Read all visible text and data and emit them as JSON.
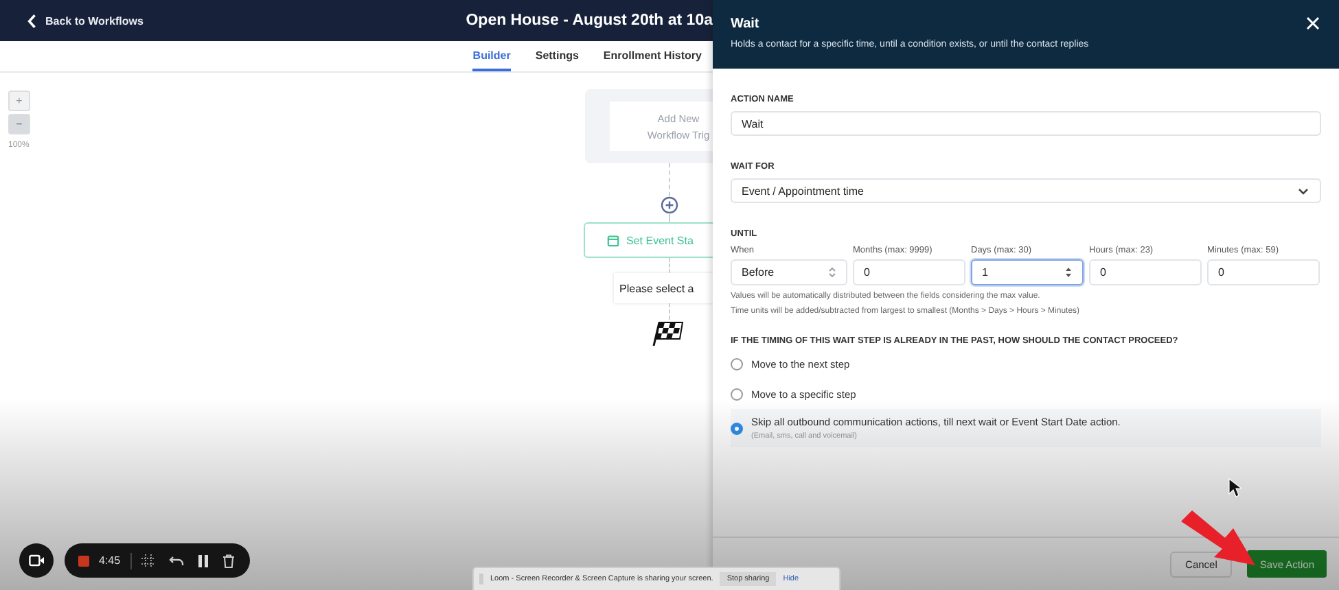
{
  "topbar": {
    "back_label": "Back to Workflows",
    "title": "Open House - August 20th at 10a"
  },
  "tabs": [
    {
      "label": "Builder",
      "selected": true
    },
    {
      "label": "Settings",
      "selected": false
    },
    {
      "label": "Enrollment History",
      "selected": false
    }
  ],
  "zoom": {
    "plus": "+",
    "minus": "−",
    "level_text": "100%"
  },
  "canvas": {
    "trigger_lines": [
      "Add New",
      "Workflow Trig"
    ],
    "action_label": "Set Event Sta",
    "prompt": "Please select a"
  },
  "panel": {
    "title": "Wait",
    "subtitle": "Holds a contact for a specific time, until a condition exists, or until the contact replies",
    "action_name_label": "ACTION NAME",
    "action_name_value": "Wait",
    "wait_for_label": "WAIT FOR",
    "wait_for_value": "Event / Appointment time",
    "until_label": "UNTIL",
    "until_fields": [
      {
        "label": "When",
        "value": "Before",
        "kind": "select",
        "focused": false
      },
      {
        "label": "Months (max: 9999)",
        "value": "0",
        "kind": "number",
        "focused": false
      },
      {
        "label": "Days (max: 30)",
        "value": "1",
        "kind": "number",
        "focused": true
      },
      {
        "label": "Hours (max: 23)",
        "value": "0",
        "kind": "number",
        "focused": false
      },
      {
        "label": "Minutes (max: 59)",
        "value": "0",
        "kind": "number",
        "focused": false
      }
    ],
    "hints": [
      "Values will be automatically distributed between the fields considering the max value.",
      "Time units will be added/subtracted from largest to smallest (Months > Days > Hours > Minutes)"
    ],
    "past_question": "IF THE TIMING OF THIS WAIT STEP IS ALREADY IN THE PAST, HOW SHOULD THE CONTACT PROCEED?",
    "past_options": [
      {
        "label": "Move to the next step",
        "selected": false
      },
      {
        "label": "Move to a specific step",
        "selected": false
      },
      {
        "label": "Skip all outbound communication actions, till next wait or Event Start Date action.",
        "note": "(Email, sms, call and voicemail)",
        "selected": true
      }
    ],
    "buttons": [
      "Cancel",
      "Save Action"
    ]
  },
  "recorder": {
    "time": "4:45"
  },
  "sharing_bar": {
    "message": "Loom - Screen Recorder & Screen Capture is sharing your screen.",
    "stop_button": "Stop sharing",
    "hide_link": "Hide"
  }
}
